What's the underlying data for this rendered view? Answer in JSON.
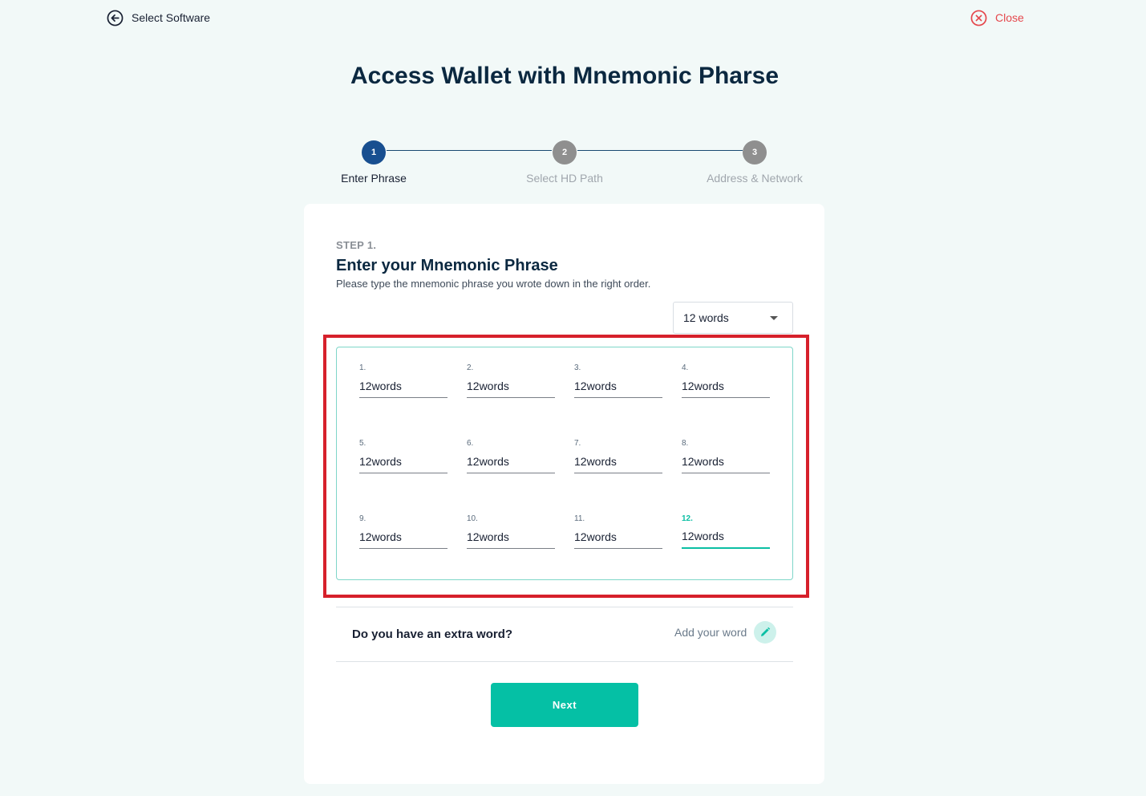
{
  "header": {
    "back_label": "Select Software",
    "close_label": "Close"
  },
  "page_title": "Access Wallet with Mnemonic Pharse",
  "stepper": {
    "steps": [
      {
        "number": "1",
        "label": "Enter Phrase",
        "state": "active"
      },
      {
        "number": "2",
        "label": "Select HD Path",
        "state": "inactive"
      },
      {
        "number": "3",
        "label": "Address & Network",
        "state": "inactive"
      }
    ]
  },
  "card": {
    "step_tag": "STEP 1.",
    "heading": "Enter your Mnemonic Phrase",
    "subtitle": "Please type the mnemonic phrase you wrote down in the right order.",
    "word_count_select": {
      "selected": "12 words"
    },
    "words": [
      {
        "num": "1.",
        "value": "12words"
      },
      {
        "num": "2.",
        "value": "12words"
      },
      {
        "num": "3.",
        "value": "12words"
      },
      {
        "num": "4.",
        "value": "12words"
      },
      {
        "num": "5.",
        "value": "12words"
      },
      {
        "num": "6.",
        "value": "12words"
      },
      {
        "num": "7.",
        "value": "12words"
      },
      {
        "num": "8.",
        "value": "12words"
      },
      {
        "num": "9.",
        "value": "12words"
      },
      {
        "num": "10.",
        "value": "12words"
      },
      {
        "num": "11.",
        "value": "12words"
      },
      {
        "num": "12.",
        "value": "12words"
      }
    ],
    "focused_word_index": 11,
    "extra_word_question": "Do you have an extra word?",
    "add_word_label": "Add your word",
    "next_label": "Next"
  },
  "colors": {
    "accent": "#05c0a5",
    "primary_navy": "#184f90",
    "close_red": "#e5484d",
    "highlight_frame": "#d6202b"
  }
}
